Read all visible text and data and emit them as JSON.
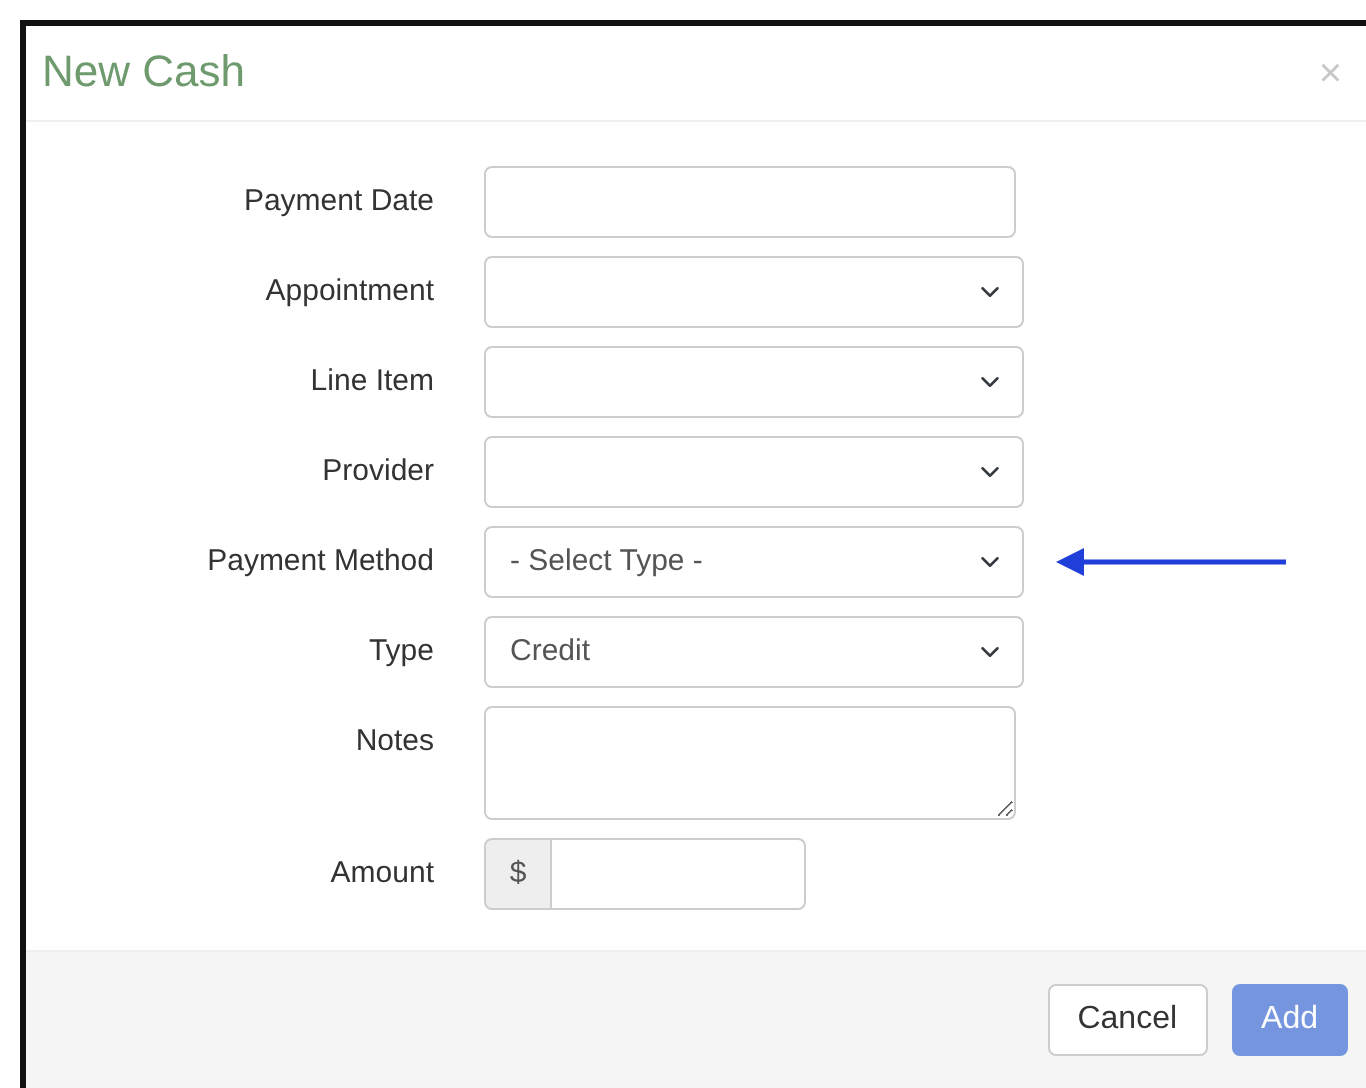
{
  "dialog": {
    "title": "New Cash",
    "close": "×"
  },
  "fields": [
    {
      "kind": "text",
      "label": "Payment Date"
    },
    {
      "kind": "select",
      "label": "Appointment"
    },
    {
      "kind": "select",
      "label": "Line Item"
    },
    {
      "kind": "select",
      "label": "Provider"
    },
    {
      "kind": "select",
      "label": "Payment Method",
      "value": "- Select Type -"
    },
    {
      "kind": "select",
      "label": "Type",
      "value": "Credit"
    },
    {
      "kind": "textarea",
      "label": "Notes"
    },
    {
      "kind": "money",
      "label": "Amount",
      "prefix": "$"
    }
  ],
  "buttons": [
    {
      "label": "Cancel",
      "kind": "secondary",
      "disabled": false
    },
    {
      "label": "Add",
      "kind": "primary",
      "disabled": true
    }
  ]
}
